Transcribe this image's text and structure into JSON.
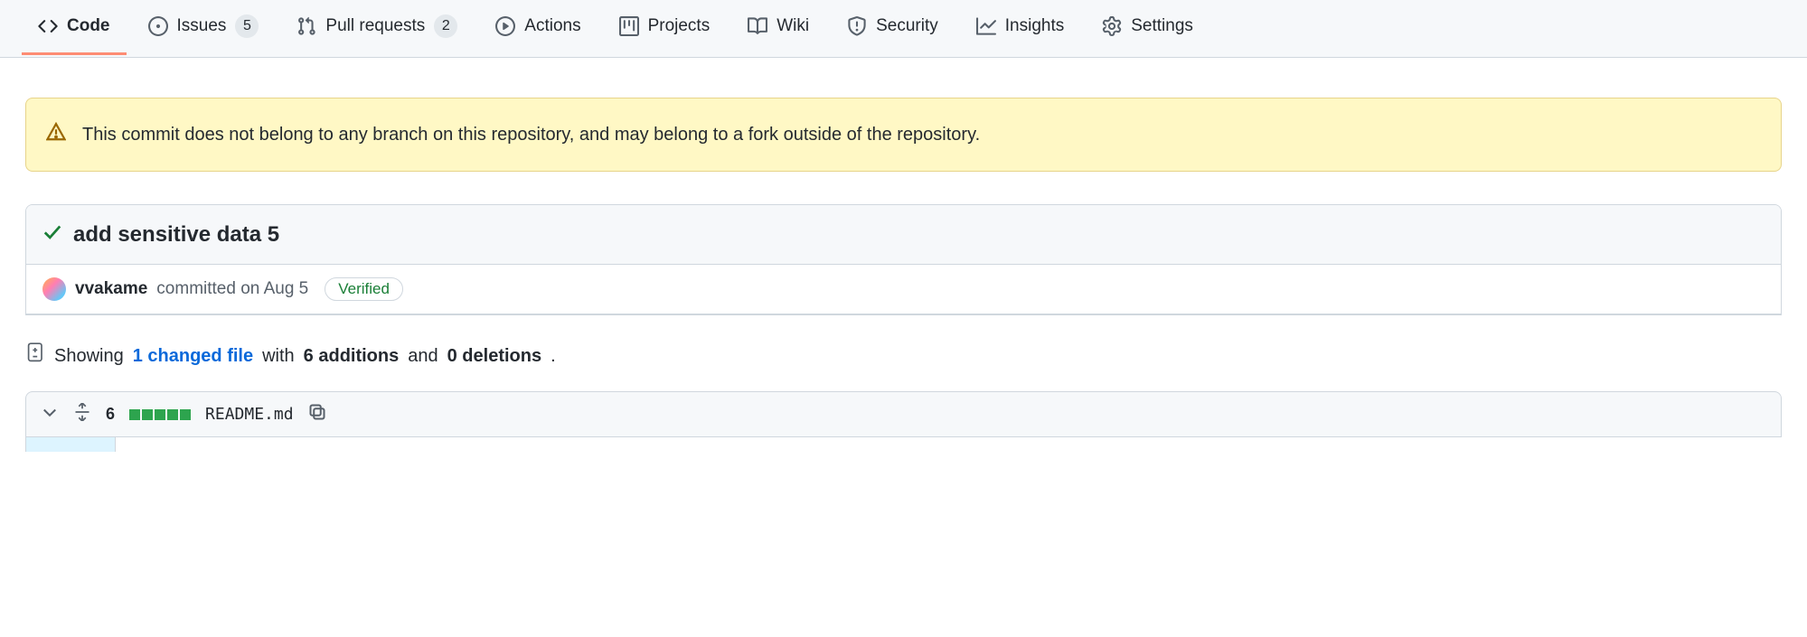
{
  "nav": {
    "code": "Code",
    "issues": {
      "label": "Issues",
      "count": "5"
    },
    "pulls": {
      "label": "Pull requests",
      "count": "2"
    },
    "actions": "Actions",
    "projects": "Projects",
    "wiki": "Wiki",
    "security": "Security",
    "insights": "Insights",
    "settings": "Settings"
  },
  "flash": {
    "text": "This commit does not belong to any branch on this repository, and may belong to a fork outside of the repository."
  },
  "commit": {
    "title": "add sensitive data 5",
    "author": "vvakame",
    "committed_text": "committed on Aug 5",
    "verified_label": "Verified"
  },
  "diffstat": {
    "showing": "Showing",
    "changed_link": "1 changed file",
    "with": "with",
    "additions": "6 additions",
    "and": "and",
    "deletions": "0 deletions",
    "period": "."
  },
  "file": {
    "change_count": "6",
    "name": "README.md"
  }
}
